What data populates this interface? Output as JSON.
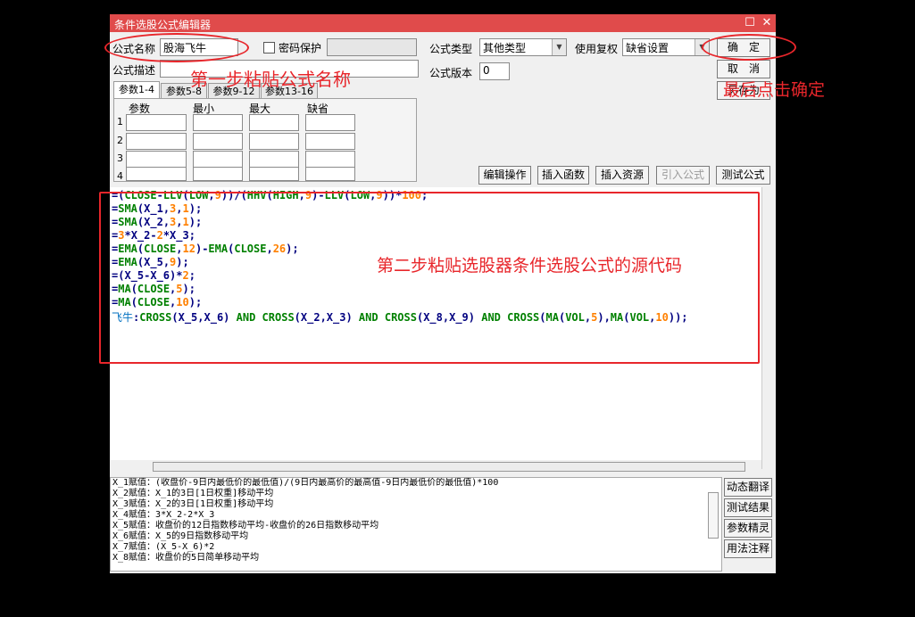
{
  "window": {
    "title": "条件选股公式编辑器",
    "maximize_glyph": "☐",
    "close_glyph": "✕"
  },
  "form": {
    "name_label": "公式名称",
    "name_value": "股海飞牛",
    "password_label": "密码保护",
    "password_value": "",
    "type_label": "公式类型",
    "type_value": "其他类型",
    "fuquan_label": "使用复权",
    "fuquan_value": "缺省设置",
    "desc_label": "公式描述",
    "desc_value": "",
    "version_label": "公式版本",
    "version_value": "0"
  },
  "buttons": {
    "ok": "确　定",
    "cancel": "取　消",
    "save_as": "另存为"
  },
  "tabs": [
    "参数1-4",
    "参数5-8",
    "参数9-12",
    "参数13-16"
  ],
  "param_table": {
    "headers": [
      "参数",
      "最小",
      "最大",
      "缺省"
    ],
    "rows": [
      "1",
      "2",
      "3",
      "4"
    ]
  },
  "toolbar": {
    "edit_ops": "编辑操作",
    "insert_func": "插入函数",
    "insert_res": "插入资源",
    "import_formula": "引入公式",
    "test_formula": "测试公式"
  },
  "code_lines": [
    [
      [
        "=(",
        "#000080"
      ],
      [
        "CLOSE",
        "#008000"
      ],
      [
        "-",
        "#000080"
      ],
      [
        "LLV",
        "#008000"
      ],
      [
        "(",
        "#000080"
      ],
      [
        "LOW",
        "#008000"
      ],
      [
        ",",
        "#000080"
      ],
      [
        "9",
        "#ff8000"
      ],
      [
        "))/(",
        "#000080"
      ],
      [
        "HHV",
        "#008000"
      ],
      [
        "(",
        "#000080"
      ],
      [
        "HIGH",
        "#008000"
      ],
      [
        ",",
        "#000080"
      ],
      [
        "9",
        "#ff8000"
      ],
      [
        ")-",
        "#000080"
      ],
      [
        "LLV",
        "#008000"
      ],
      [
        "(",
        "#000080"
      ],
      [
        "LOW",
        "#008000"
      ],
      [
        ",",
        "#000080"
      ],
      [
        "9",
        "#ff8000"
      ],
      [
        "))*",
        "#000080"
      ],
      [
        "100",
        "#ff8000"
      ],
      [
        ";",
        "#000080"
      ]
    ],
    [
      [
        "=",
        "#000080"
      ],
      [
        "SMA",
        "#008000"
      ],
      [
        "(X_1,",
        "#000080"
      ],
      [
        "3",
        "#ff8000"
      ],
      [
        ",",
        "#000080"
      ],
      [
        "1",
        "#ff8000"
      ],
      [
        ");",
        "#000080"
      ]
    ],
    [
      [
        "=",
        "#000080"
      ],
      [
        "SMA",
        "#008000"
      ],
      [
        "(X_2,",
        "#000080"
      ],
      [
        "3",
        "#ff8000"
      ],
      [
        ",",
        "#000080"
      ],
      [
        "1",
        "#ff8000"
      ],
      [
        ");",
        "#000080"
      ]
    ],
    [
      [
        "=",
        "#000080"
      ],
      [
        "3",
        "#ff8000"
      ],
      [
        "*X_2-",
        "#000080"
      ],
      [
        "2",
        "#ff8000"
      ],
      [
        "*X_3;",
        "#000080"
      ]
    ],
    [
      [
        "=",
        "#000080"
      ],
      [
        "EMA",
        "#008000"
      ],
      [
        "(",
        "#000080"
      ],
      [
        "CLOSE",
        "#008000"
      ],
      [
        ",",
        "#000080"
      ],
      [
        "12",
        "#ff8000"
      ],
      [
        ")-",
        "#000080"
      ],
      [
        "EMA",
        "#008000"
      ],
      [
        "(",
        "#000080"
      ],
      [
        "CLOSE",
        "#008000"
      ],
      [
        ",",
        "#000080"
      ],
      [
        "26",
        "#ff8000"
      ],
      [
        ");",
        "#000080"
      ]
    ],
    [
      [
        "=",
        "#000080"
      ],
      [
        "EMA",
        "#008000"
      ],
      [
        "(X_5,",
        "#000080"
      ],
      [
        "9",
        "#ff8000"
      ],
      [
        ");",
        "#000080"
      ]
    ],
    [
      [
        "=(X_5-X_6)*",
        "#000080"
      ],
      [
        "2",
        "#ff8000"
      ],
      [
        ";",
        "#000080"
      ]
    ],
    [
      [
        "=",
        "#000080"
      ],
      [
        "MA",
        "#008000"
      ],
      [
        "(",
        "#000080"
      ],
      [
        "CLOSE",
        "#008000"
      ],
      [
        ",",
        "#000080"
      ],
      [
        "5",
        "#ff8000"
      ],
      [
        ");",
        "#000080"
      ]
    ],
    [
      [
        "=",
        "#000080"
      ],
      [
        "MA",
        "#008000"
      ],
      [
        "(",
        "#000080"
      ],
      [
        "CLOSE",
        "#008000"
      ],
      [
        ",",
        "#000080"
      ],
      [
        "10",
        "#ff8000"
      ],
      [
        ");",
        "#000080"
      ]
    ],
    [
      [
        "飞牛",
        "#0070c0"
      ],
      [
        ":",
        "#000080"
      ],
      [
        "CROSS",
        "#008000"
      ],
      [
        "(X_5,X_6) ",
        "#000080"
      ],
      [
        "AND",
        "#008000"
      ],
      [
        " ",
        "#000080"
      ],
      [
        "CROSS",
        "#008000"
      ],
      [
        "(X_2,X_3) ",
        "#000080"
      ],
      [
        "AND",
        "#008000"
      ],
      [
        " ",
        "#000080"
      ],
      [
        "CROSS",
        "#008000"
      ],
      [
        "(X_8,X_9) ",
        "#000080"
      ],
      [
        "AND",
        "#008000"
      ],
      [
        " ",
        "#000080"
      ],
      [
        "CROSS",
        "#008000"
      ],
      [
        "(",
        "#000080"
      ],
      [
        "MA",
        "#008000"
      ],
      [
        "(",
        "#000080"
      ],
      [
        "VOL",
        "#008000"
      ],
      [
        ",",
        "#000080"
      ],
      [
        "5",
        "#ff8000"
      ],
      [
        "),",
        "#000080"
      ],
      [
        "MA",
        "#008000"
      ],
      [
        "(",
        "#000080"
      ],
      [
        "VOL",
        "#008000"
      ],
      [
        ",",
        "#000080"
      ],
      [
        "10",
        "#ff8000"
      ],
      [
        "));",
        "#000080"
      ]
    ]
  ],
  "description_lines": [
    "X_1赋值：(收盘价-9日内最低价的最低值)/(9日内最高价的最高值-9日内最低价的最低值)*100",
    "X_2赋值：X_1的3日[1日权重]移动平均",
    "X_3赋值：X_2的3日[1日权重]移动平均",
    "X_4赋值：3*X_2-2*X_3",
    "X_5赋值：收盘价的12日指数移动平均-收盘价的26日指数移动平均",
    "X_6赋值：X_5的9日指数移动平均",
    "X_7赋值：(X_5-X_6)*2",
    "X_8赋值：收盘价的5日简单移动平均"
  ],
  "side_buttons": [
    "动态翻译",
    "测试结果",
    "参数精灵",
    "用法注释"
  ],
  "annotations": {
    "step1": "第一步粘贴公式名称",
    "step2": "第二步粘贴选股器条件选股公式的源代码",
    "final": "最后点击确定"
  },
  "colors": {
    "annotation": "#e8262b",
    "titlebar": "#e04b4b",
    "keyword": "#008000",
    "number": "#ff8000",
    "operator": "#000080",
    "name": "#0070c0"
  }
}
